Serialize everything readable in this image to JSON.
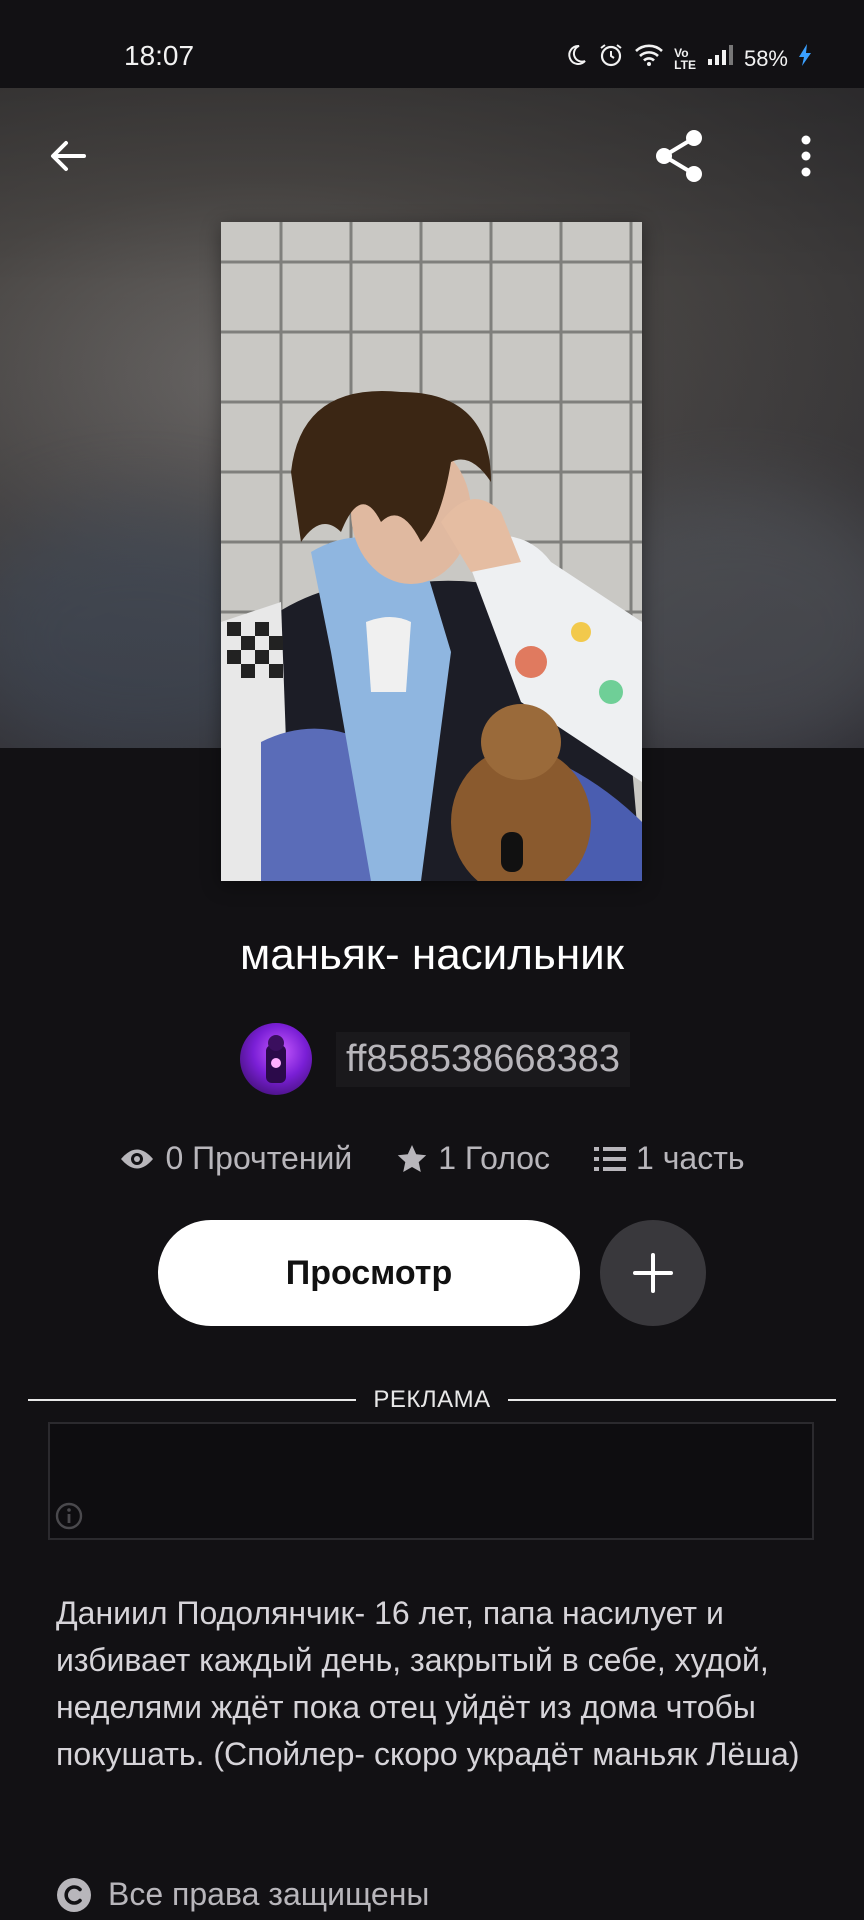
{
  "status_bar": {
    "time": "18:07",
    "battery": "58%",
    "icons": [
      "moon-icon",
      "alarm-icon",
      "wifi-icon",
      "volte-icon",
      "signal-icon",
      "battery-charging-icon"
    ]
  },
  "toolbar": {
    "back_icon": "arrow-left-icon",
    "share_icon": "share-icon",
    "more_icon": "more-vertical-icon"
  },
  "story": {
    "title": "маньяк- насильник",
    "author": "ff858538668383",
    "stats": {
      "reads": "0 Прочтений",
      "votes": "1 Голос",
      "parts": "1 часть"
    },
    "read_button": "Просмотр",
    "description": "Даниил Подолянчик- 16 лет, папа насилует и избивает каждый день, закрытый в себе, худой, неделями ждёт пока отец уйдёт из дома чтобы покушать. (Спойлер- скоро украдёт маньяк Лёша)",
    "copyright": "Все права защищены"
  },
  "ad": {
    "label": "РЕКЛАМА"
  },
  "colors": {
    "background": "#121114",
    "button_primary": "#ffffff",
    "button_secondary": "#39383c",
    "muted_text": "#b8b6bb"
  }
}
